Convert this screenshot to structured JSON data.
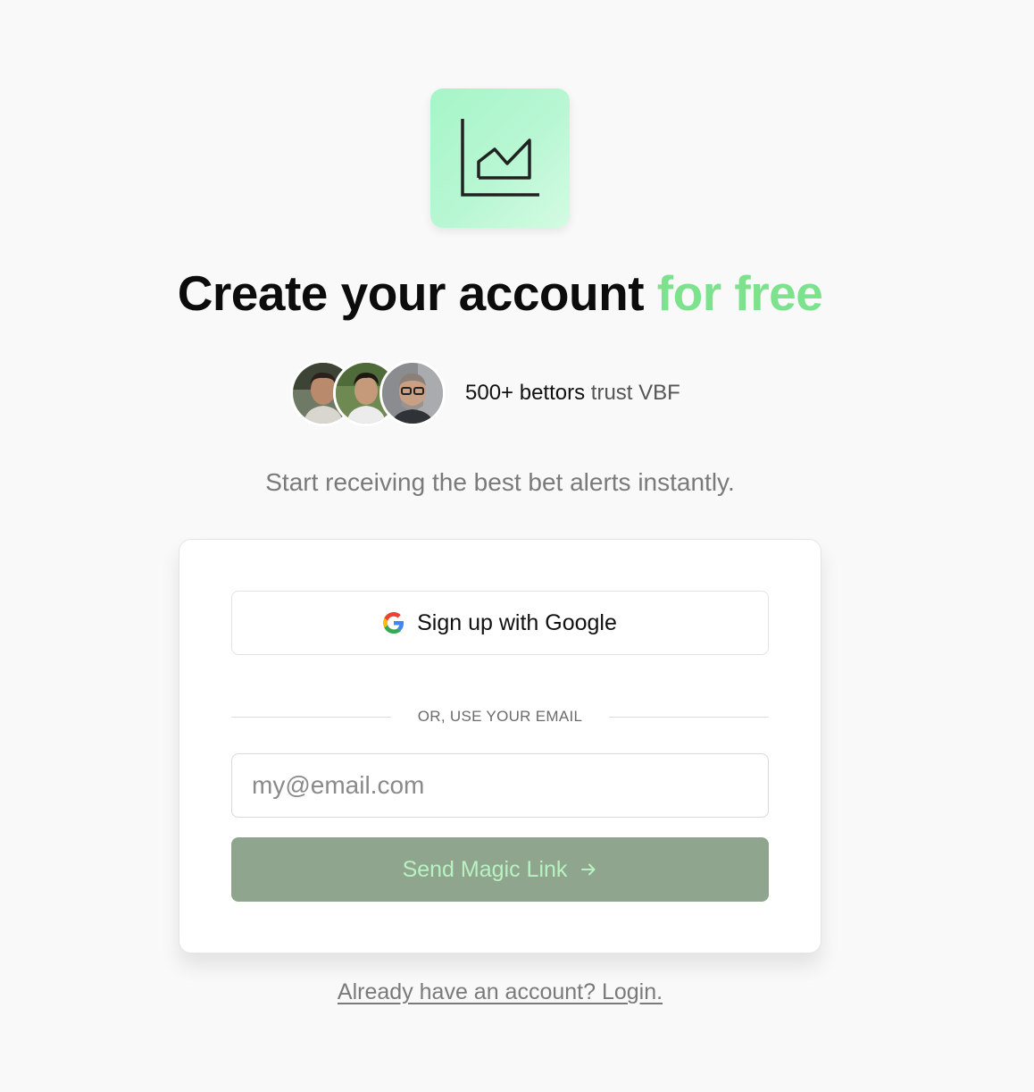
{
  "logo": {
    "icon": "area-chart-icon"
  },
  "heading": {
    "main": "Create your account ",
    "accent": "for free",
    "accent_color": "#7de28d"
  },
  "social_proof": {
    "count": "500+ bettors",
    "suffix": " trust VBF",
    "avatars": [
      "user-avatar-1",
      "user-avatar-2",
      "user-avatar-3"
    ]
  },
  "subtitle": "Start receiving the best bet alerts instantly.",
  "card": {
    "google_button": {
      "label": "Sign up with Google",
      "icon": "google-icon"
    },
    "divider_text": "OR, USE YOUR EMAIL",
    "email_input": {
      "placeholder": "my@email.com",
      "value": ""
    },
    "magic_button": {
      "label": "Send Magic Link",
      "icon": "arrow-right-icon",
      "color": "#8fa58e"
    }
  },
  "login_link": "Already have an account? Login."
}
